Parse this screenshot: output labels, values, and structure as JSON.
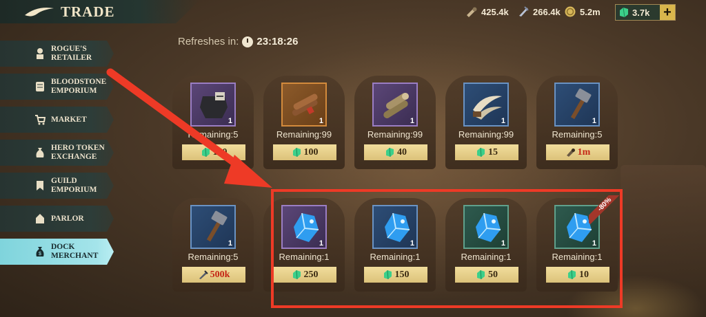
{
  "header": {
    "title": "TRADE",
    "back_icon": "back-arrow-icon"
  },
  "resources": [
    {
      "icon": "wood-icon",
      "value": "425.4k"
    },
    {
      "icon": "ore-icon",
      "value": "266.4k"
    },
    {
      "icon": "coin-icon",
      "value": "5.2m"
    }
  ],
  "gems": {
    "icon": "gem-icon",
    "value": "3.7k",
    "plus_label": "+"
  },
  "refresh": {
    "label": "Refreshes in:",
    "time": "23:18:26"
  },
  "sidebar": {
    "items": [
      {
        "label": "ROGUE'S\nRETAILER",
        "icon": "merchant-icon",
        "active": false
      },
      {
        "label": "BLOODSTONE\nEMPORIUM",
        "icon": "scroll-icon",
        "active": false
      },
      {
        "label": "MARKET",
        "icon": "cart-icon",
        "active": false
      },
      {
        "label": "HERO TOKEN\nEXCHANGE",
        "icon": "coin-bag-icon",
        "active": false
      },
      {
        "label": "GUILD\nEMPORIUM",
        "icon": "banner-icon",
        "active": false
      },
      {
        "label": "PARLOR",
        "icon": "parlor-icon",
        "active": false
      },
      {
        "label": "DOCK\nMERCHANT",
        "icon": "money-bag-icon",
        "active": true
      }
    ]
  },
  "shop_items": [
    {
      "icon": "armor-icon",
      "rarity": "purple",
      "qty": "1",
      "remaining": "Remaining:5",
      "price": "100",
      "currency": "gem-icon",
      "price_red": false
    },
    {
      "icon": "cigars-icon",
      "rarity": "orange",
      "qty": "1",
      "remaining": "Remaining:99",
      "price": "100",
      "currency": "gem-icon",
      "price_red": false
    },
    {
      "icon": "logs-icon",
      "rarity": "purple",
      "qty": "1",
      "remaining": "Remaining:99",
      "price": "40",
      "currency": "gem-icon",
      "price_red": false
    },
    {
      "icon": "horns-icon",
      "rarity": "blue",
      "qty": "1",
      "remaining": "Remaining:99",
      "price": "15",
      "currency": "gem-icon",
      "price_red": false
    },
    {
      "icon": "hammer-icon",
      "rarity": "blue",
      "qty": "1",
      "remaining": "Remaining:5",
      "price": "1m",
      "currency": "wood-icon",
      "price_red": true
    },
    {
      "icon": "hammer-icon",
      "rarity": "blue",
      "qty": "1",
      "remaining": "Remaining:5",
      "price": "500k",
      "currency": "ore-icon",
      "price_red": true
    },
    {
      "icon": "crystal-icon",
      "rarity": "purple",
      "qty": "1",
      "remaining": "Remaining:1",
      "price": "250",
      "currency": "gem-icon",
      "price_red": false
    },
    {
      "icon": "crystal-icon",
      "rarity": "blue",
      "qty": "1",
      "remaining": "Remaining:1",
      "price": "150",
      "currency": "gem-icon",
      "price_red": false
    },
    {
      "icon": "crystal-icon",
      "rarity": "green",
      "qty": "1",
      "remaining": "Remaining:1",
      "price": "50",
      "currency": "gem-icon",
      "price_red": false
    },
    {
      "icon": "crystal-icon",
      "rarity": "green",
      "qty": "1",
      "remaining": "Remaining:1",
      "price": "10",
      "currency": "gem-icon",
      "price_red": false,
      "discount": "-80%"
    }
  ],
  "colors": {
    "highlight": "#ee3a26",
    "gem": "#3ccf8a",
    "active_tab": "#8fdbe2"
  }
}
